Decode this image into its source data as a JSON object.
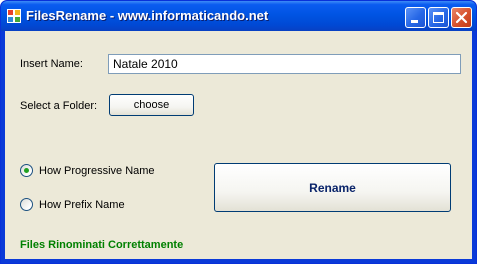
{
  "window": {
    "title": "FilesRename - www.informaticando.net",
    "icon": "app-icon",
    "controls": [
      "minimize-icon",
      "maximize-icon",
      "close-icon"
    ]
  },
  "form": {
    "name_label": "Insert Name:",
    "name_value": "Natale 2010",
    "folder_label": "Select a Folder:",
    "choose_label": "choose",
    "options": [
      {
        "label": "How Progressive Name",
        "selected": true
      },
      {
        "label": "How Prefix Name",
        "selected": false
      }
    ],
    "rename_label": "Rename",
    "status_text": "Files Rinominati Correttamente"
  },
  "colors": {
    "status": "#008000",
    "radio_dot": "#21a121",
    "titlebar": "#0054e3",
    "window_bg": "#ece9d8"
  }
}
